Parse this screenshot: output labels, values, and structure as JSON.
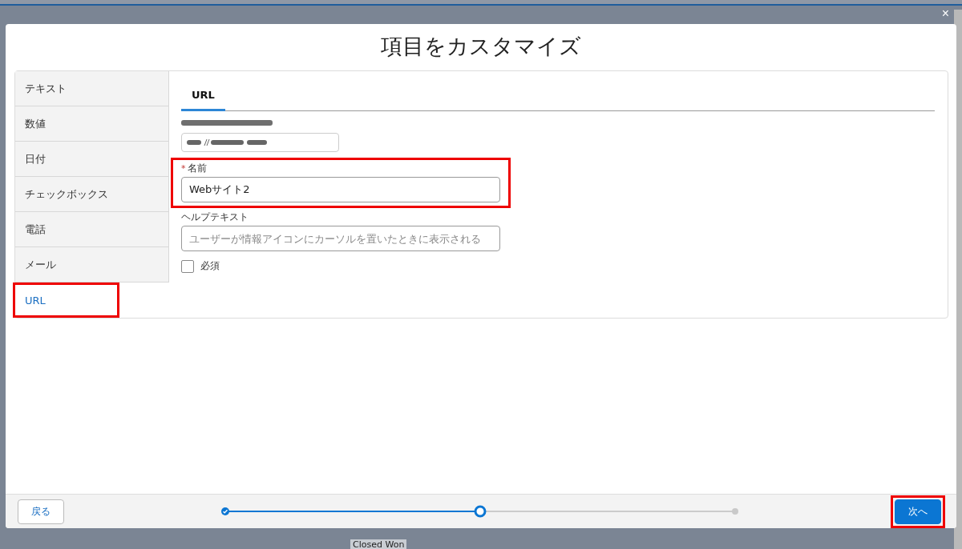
{
  "background": {
    "texts": [
      "Closed Won"
    ]
  },
  "modal": {
    "title": "項目をカスタマイズ",
    "close": "×"
  },
  "sidebar": {
    "items": [
      {
        "label": "テキスト",
        "selected": false,
        "highlighted": false
      },
      {
        "label": "数値",
        "selected": false,
        "highlighted": false
      },
      {
        "label": "日付",
        "selected": false,
        "highlighted": false
      },
      {
        "label": "チェックボックス",
        "selected": false,
        "highlighted": false
      },
      {
        "label": "電話",
        "selected": false,
        "highlighted": false
      },
      {
        "label": "メール",
        "selected": false,
        "highlighted": false
      },
      {
        "label": "URL",
        "selected": true,
        "highlighted": true
      }
    ]
  },
  "content": {
    "tabs": [
      {
        "label": "URL",
        "selected": true
      }
    ],
    "name_field": {
      "label": "名前",
      "required": true,
      "required_mark": "*",
      "value": "Webサイト2",
      "highlighted": true
    },
    "help_field": {
      "label": "ヘルプテキスト",
      "placeholder": "ユーザーが情報アイコンにカーソルを置いたときに表示される"
    },
    "required_checkbox": {
      "label": "必須",
      "checked": false
    }
  },
  "footer": {
    "back": "戻る",
    "next": {
      "label": "次へ",
      "highlighted": true
    },
    "progress": {
      "level": 0.5,
      "steps": [
        {
          "kind": "done"
        },
        {
          "kind": "current"
        },
        {
          "kind": "upcoming"
        }
      ]
    }
  }
}
